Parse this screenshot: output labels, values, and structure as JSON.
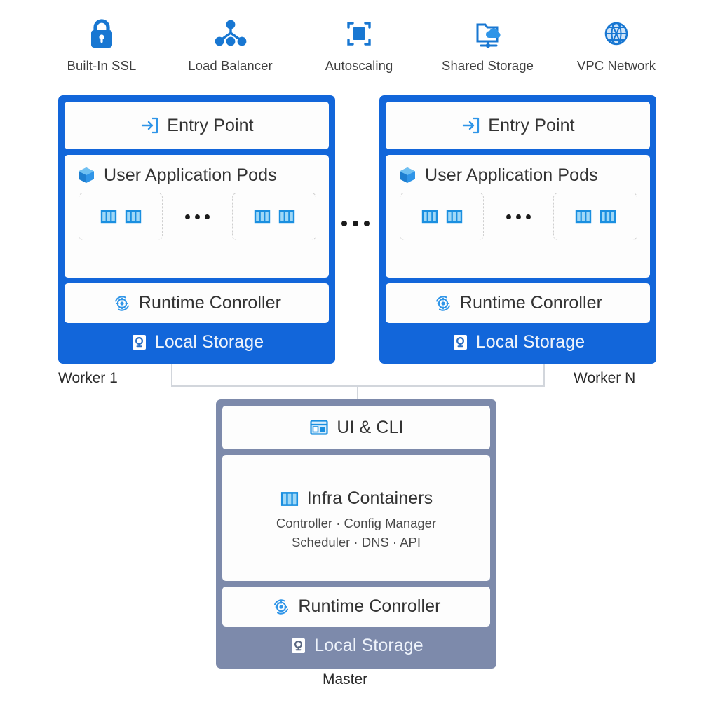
{
  "features": [
    {
      "label": "Built-In SSL",
      "icon": "lock-icon"
    },
    {
      "label": "Load Balancer",
      "icon": "load-balancer-icon"
    },
    {
      "label": "Autoscaling",
      "icon": "autoscaling-icon"
    },
    {
      "label": "Shared Storage",
      "icon": "shared-storage-icon"
    },
    {
      "label": "VPC Network",
      "icon": "vpc-network-icon"
    }
  ],
  "workers": [
    {
      "caption": "Worker 1",
      "entry_point": "Entry Point",
      "pods_title": "User Application Pods",
      "pods_ellipsis": "...",
      "runtime": "Runtime Conroller",
      "storage": "Local Storage"
    },
    {
      "caption": "Worker N",
      "entry_point": "Entry Point",
      "pods_title": "User Application Pods",
      "pods_ellipsis": "...",
      "runtime": "Runtime Conroller",
      "storage": "Local Storage"
    }
  ],
  "inter_worker_ellipsis": "...",
  "master": {
    "caption": "Master",
    "ui_cli": "UI & CLI",
    "infra_title": "Infra Containers",
    "infra_line_1": "Controller · Config Manager",
    "infra_line_2": "Scheduler · DNS · API",
    "runtime": "Runtime Conroller",
    "storage": "Local Storage"
  },
  "colors": {
    "worker_blue": "#1266da",
    "master_slate": "#7d8aab",
    "icon_blue": "#1a8fe0",
    "accent_blue": "#1877d2",
    "panel_white": "#fdfdfd",
    "connector_gray": "#d2d6dc",
    "text_dark": "#333333"
  }
}
